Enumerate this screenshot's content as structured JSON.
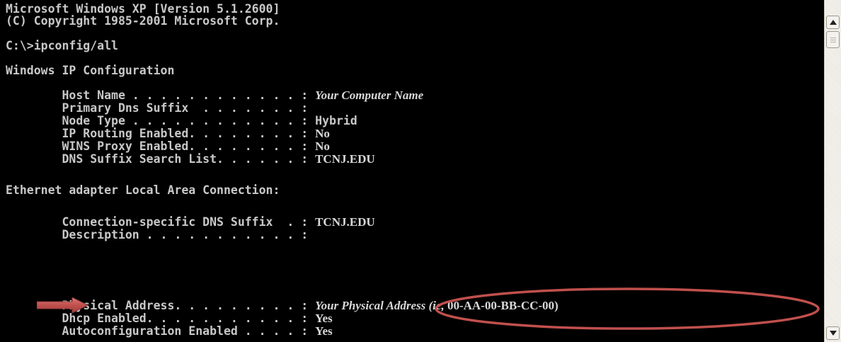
{
  "console": {
    "header": [
      "Microsoft Windows XP [Version 5.1.2600]",
      "(C) Copyright 1985-2001 Microsoft Corp."
    ],
    "command": "C:\\>ipconfig/all",
    "section_ip": "Windows IP Configuration",
    "ip_config": [
      {
        "key": "        Host Name . . . . . . . . . . . . : ",
        "value": "Your Computer Name"
      },
      {
        "key": "        Primary Dns Suffix  . . . . . . . : ",
        "value": ""
      },
      {
        "key": "        Node Type . . . . . . . . . . . . : ",
        "value": "Hybrid"
      },
      {
        "key": "        IP Routing Enabled. . . . . . . . : ",
        "value": "No"
      },
      {
        "key": "        WINS Proxy Enabled. . . . . . . . : ",
        "value": "No"
      },
      {
        "key": "        DNS Suffix Search List. . . . . . : ",
        "value": "TCNJ.EDU"
      }
    ],
    "section_ethernet": "Ethernet adapter Local Area Connection:",
    "ethernet": [
      {
        "key": "        Connection-specific DNS Suffix  . : ",
        "value": "TCNJ.EDU"
      },
      {
        "key": "        Description . . . . . . . . . . . : ",
        "value": ""
      },
      {
        "key": "        Physical Address. . . . . . . . . : ",
        "value_italic": "Your Physical Address (ie, ",
        "value_plain": "00-AA-00-BB-CC-00)"
      },
      {
        "key": "        Dhcp Enabled. . . . . . . . . . . : ",
        "value": "Yes"
      },
      {
        "key": "        Autoconfiguration Enabled . . . . : ",
        "value": "Yes"
      }
    ]
  },
  "colors": {
    "console_bg": "#000000",
    "console_text": "#c8c8c8",
    "annotation": "#c0504d"
  },
  "icons": {
    "arrow": "right-arrow-icon",
    "scroll_up": "chevron-up-icon",
    "scroll_down": "chevron-down-icon"
  }
}
